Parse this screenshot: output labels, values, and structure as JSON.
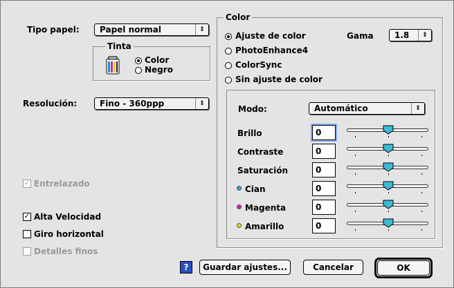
{
  "paper": {
    "label": "Tipo papel:",
    "value": "Papel normal"
  },
  "ink": {
    "title": "Tinta",
    "options": [
      {
        "label": "Color",
        "selected": true
      },
      {
        "label": "Negro",
        "selected": false
      }
    ]
  },
  "resolution": {
    "label": "Resolución:",
    "value": "Fino - 360ppp"
  },
  "checkboxes": {
    "interlaced": {
      "label": "Entrelazado",
      "checked": true,
      "disabled": true
    },
    "high_speed": {
      "label": "Alta Velocidad",
      "checked": true,
      "disabled": false
    },
    "flip_horizontal": {
      "label": "Giro horizontal",
      "checked": false,
      "disabled": false
    },
    "fine_detail": {
      "label": "Detalles finos",
      "checked": false,
      "disabled": true
    }
  },
  "color": {
    "title": "Color",
    "options": [
      {
        "label": "Ajuste de color",
        "selected": true
      },
      {
        "label": "PhotoEnhance4",
        "selected": false
      },
      {
        "label": "ColorSync",
        "selected": false
      },
      {
        "label": "Sin ajuste de color",
        "selected": false
      }
    ],
    "gamma": {
      "label": "Gama",
      "value": "1.8"
    },
    "mode": {
      "label": "Modo:",
      "value": "Automático"
    },
    "sliders": [
      {
        "label": "Brillo",
        "value": "0",
        "swatch": null,
        "level": 0.5
      },
      {
        "label": "Contraste",
        "value": "0",
        "swatch": null,
        "level": 0.5
      },
      {
        "label": "Saturación",
        "value": "0",
        "swatch": null,
        "level": 0.5
      },
      {
        "label": "Cian",
        "value": "0",
        "swatch": "#22a8e0",
        "level": 0.5
      },
      {
        "label": "Magenta",
        "value": "0",
        "swatch": "#d024a8",
        "level": 0.5
      },
      {
        "label": "Amarillo",
        "value": "0",
        "swatch": "#e6d21e",
        "level": 0.5
      }
    ]
  },
  "buttons": {
    "help": "?",
    "save": "Guardar ajustes...",
    "cancel": "Cancelar",
    "ok": "OK"
  },
  "colors": {
    "thumb": "#3fb9d6",
    "window": "#e4e4e4",
    "help_bg": "#2a4fc4"
  },
  "icons": {
    "ink_cartridge": "ink-cartridge-icon",
    "popup_arrow": "updown-arrow-icon"
  }
}
